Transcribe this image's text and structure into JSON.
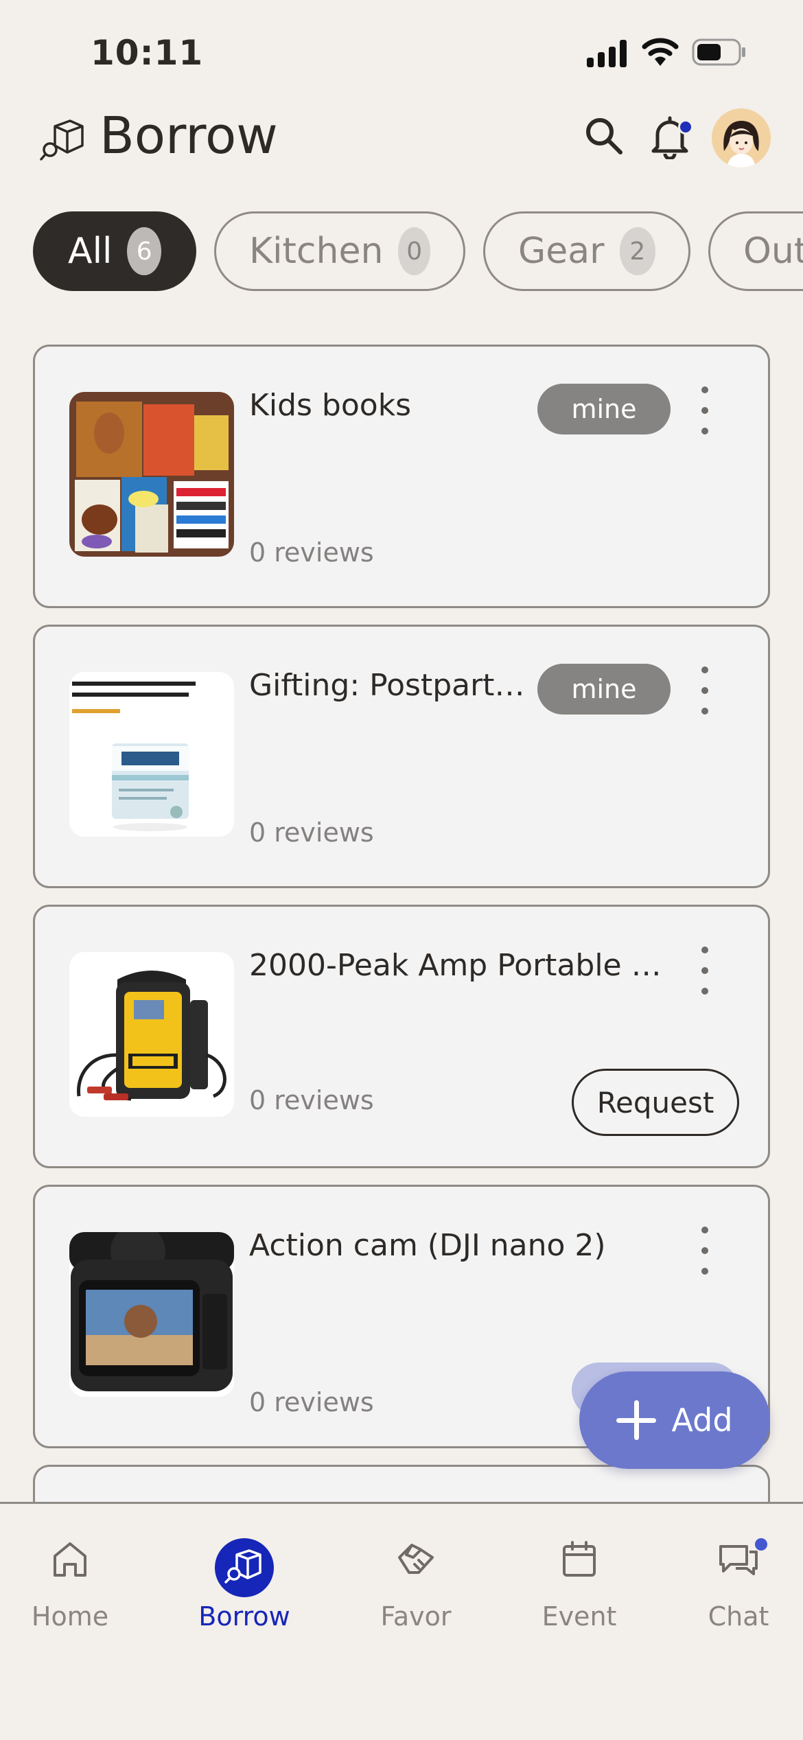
{
  "status_bar": {
    "time": "10:11"
  },
  "header": {
    "title": "Borrow"
  },
  "filters": [
    {
      "label": "All",
      "count": "6",
      "active": true
    },
    {
      "label": "Kitchen",
      "count": "0",
      "active": false
    },
    {
      "label": "Gear",
      "count": "2",
      "active": false
    },
    {
      "label": "Out",
      "count": "",
      "active": false
    }
  ],
  "items": [
    {
      "title": "Kids books",
      "badge": "mine",
      "reviews": "0 reviews"
    },
    {
      "title": "Gifting: Postpartu...",
      "badge": "mine",
      "reviews": "0 reviews"
    },
    {
      "title": "2000-Peak Amp Portable b...",
      "reviews": "0 reviews",
      "action": "Request"
    },
    {
      "title": "Action cam (DJI nano 2)",
      "reviews": "0 reviews"
    }
  ],
  "fab": {
    "label": "Add"
  },
  "nav": [
    {
      "label": "Home"
    },
    {
      "label": "Borrow"
    },
    {
      "label": "Favor"
    },
    {
      "label": "Event"
    },
    {
      "label": "Chat"
    }
  ],
  "colors": {
    "accent": "#1626b8",
    "fab": "#6b78cc",
    "background": "#f3efea"
  }
}
